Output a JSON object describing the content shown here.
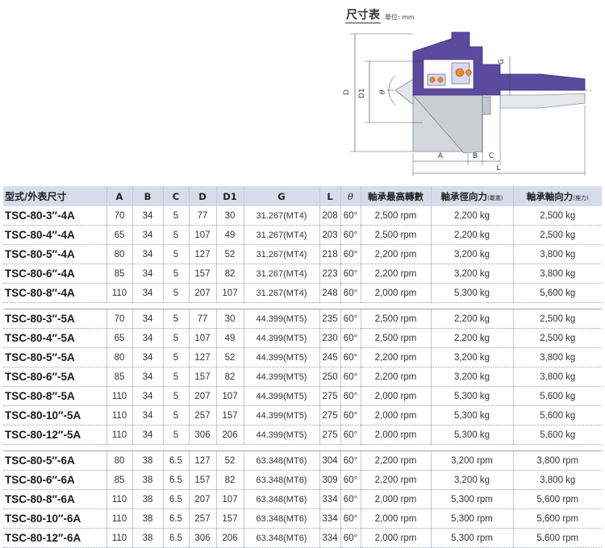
{
  "dimension_panel": {
    "title": "尺寸表",
    "unit": "單位: mm",
    "labels": {
      "D": "D",
      "D1": "D1",
      "theta": "θ",
      "G": "G",
      "A": "A",
      "B": "B",
      "C": "C",
      "L": "L"
    }
  },
  "table": {
    "headers": {
      "model": "型式/外表尺寸",
      "A": "A",
      "B": "B",
      "C": "C",
      "D": "D",
      "D1": "D1",
      "G": "G",
      "L": "L",
      "theta": "θ",
      "max_speed": "軸承最高轉數",
      "radial": "軸承徑向力",
      "radial_note": "(載重)",
      "axial": "軸承軸向力",
      "axial_note": "(推力)"
    },
    "groups": [
      {
        "rows": [
          {
            "model": "TSC-80-3″-4A",
            "A": "70",
            "B": "34",
            "C": "5",
            "D": "77",
            "D1": "30",
            "G": "31.267(MT4)",
            "L": "208",
            "theta": "60°",
            "max_speed": "2,500 rpm",
            "radial": "2,200 kg",
            "axial": "2,500 kg"
          },
          {
            "model": "TSC-80-4″-4A",
            "A": "65",
            "B": "34",
            "C": "5",
            "D": "107",
            "D1": "49",
            "G": "31.267(MT4)",
            "L": "203",
            "theta": "60°",
            "max_speed": "2,500 rpm",
            "radial": "2,200 kg",
            "axial": "2,500 kg"
          },
          {
            "model": "TSC-80-5″-4A",
            "A": "80",
            "B": "34",
            "C": "5",
            "D": "127",
            "D1": "52",
            "G": "31.267(MT4)",
            "L": "218",
            "theta": "60°",
            "max_speed": "2,200 rpm",
            "radial": "3,200 kg",
            "axial": "3,800 kg"
          },
          {
            "model": "TSC-80-6″-4A",
            "A": "85",
            "B": "34",
            "C": "5",
            "D": "157",
            "D1": "82",
            "G": "31.267(MT4)",
            "L": "223",
            "theta": "60°",
            "max_speed": "2,200 rpm",
            "radial": "3,200 kg",
            "axial": "3,800 kg"
          },
          {
            "model": "TSC-80-8″-4A",
            "A": "110",
            "B": "34",
            "C": "5",
            "D": "207",
            "D1": "107",
            "G": "31.267(MT4)",
            "L": "248",
            "theta": "60°",
            "max_speed": "2,000 rpm",
            "radial": "5,300 kg",
            "axial": "5,600 kg"
          }
        ]
      },
      {
        "rows": [
          {
            "model": "TSC-80-3″-5A",
            "A": "70",
            "B": "34",
            "C": "5",
            "D": "77",
            "D1": "30",
            "G": "44.399(MT5)",
            "L": "235",
            "theta": "60°",
            "max_speed": "2,500 rpm",
            "radial": "2,200 kg",
            "axial": "2,500 kg"
          },
          {
            "model": "TSC-80-4″-5A",
            "A": "65",
            "B": "34",
            "C": "5",
            "D": "107",
            "D1": "49",
            "G": "44.399(MT5)",
            "L": "230",
            "theta": "60°",
            "max_speed": "2,500 rpm",
            "radial": "2,200 kg",
            "axial": "2,500 kg"
          },
          {
            "model": "TSC-80-5″-5A",
            "A": "80",
            "B": "34",
            "C": "5",
            "D": "127",
            "D1": "52",
            "G": "44.399(MT5)",
            "L": "245",
            "theta": "60°",
            "max_speed": "2,200 rpm",
            "radial": "3,200 kg",
            "axial": "3,800 kg"
          },
          {
            "model": "TSC-80-6″-5A",
            "A": "85",
            "B": "34",
            "C": "5",
            "D": "157",
            "D1": "82",
            "G": "44.399(MT5)",
            "L": "250",
            "theta": "60°",
            "max_speed": "2,200 rpm",
            "radial": "3,200 kg",
            "axial": "3,800 kg"
          },
          {
            "model": "TSC-80-8″-5A",
            "A": "110",
            "B": "34",
            "C": "5",
            "D": "207",
            "D1": "107",
            "G": "44.399(MT5)",
            "L": "275",
            "theta": "60°",
            "max_speed": "2,000 rpm",
            "radial": "5,300 kg",
            "axial": "5,600 kg"
          },
          {
            "model": "TSC-80-10″-5A",
            "A": "110",
            "B": "34",
            "C": "5",
            "D": "257",
            "D1": "157",
            "G": "44.399(MT5)",
            "L": "275",
            "theta": "60°",
            "max_speed": "2,000 rpm",
            "radial": "5,300 kg",
            "axial": "5,600 kg"
          },
          {
            "model": "TSC-80-12″-5A",
            "A": "110",
            "B": "34",
            "C": "5",
            "D": "306",
            "D1": "206",
            "G": "44.399(MT5)",
            "L": "275",
            "theta": "60°",
            "max_speed": "2,000 rpm",
            "radial": "5,300 kg",
            "axial": "5,600 kg"
          }
        ]
      },
      {
        "rows": [
          {
            "model": "TSC-80-5″-6A",
            "A": "80",
            "B": "38",
            "C": "6.5",
            "D": "127",
            "D1": "52",
            "G": "63.348(MT6)",
            "L": "304",
            "theta": "60°",
            "max_speed": "2,200 rpm",
            "radial": "3,200 rpm",
            "axial": "3,800 rpm"
          },
          {
            "model": "TSC-80-6″-6A",
            "A": "85",
            "B": "38",
            "C": "6.5",
            "D": "157",
            "D1": "82",
            "G": "63.348(MT6)",
            "L": "309",
            "theta": "60°",
            "max_speed": "2,200 rpm",
            "radial": "3,200 kg",
            "axial": "3,800 kg"
          },
          {
            "model": "TSC-80-8″-6A",
            "A": "110",
            "B": "38",
            "C": "6.5",
            "D": "207",
            "D1": "107",
            "G": "63.348(MT6)",
            "L": "334",
            "theta": "60°",
            "max_speed": "2,000 rpm",
            "radial": "5,300 rpm",
            "axial": "5,600 rpm"
          },
          {
            "model": "TSC-80-10″-6A",
            "A": "110",
            "B": "38",
            "C": "6.5",
            "D": "257",
            "D1": "157",
            "G": "63.348(MT6)",
            "L": "334",
            "theta": "60°",
            "max_speed": "2,000 rpm",
            "radial": "5,300 rpm",
            "axial": "5,600 rpm"
          },
          {
            "model": "TSC-80-12″-6A",
            "A": "110",
            "B": "38",
            "C": "6.5",
            "D": "306",
            "D1": "206",
            "G": "63.348(MT6)",
            "L": "334",
            "theta": "60°",
            "max_speed": "2,000 rpm",
            "radial": "5,300 rpm",
            "axial": "5,600 rpm"
          }
        ]
      }
    ]
  },
  "colors": {
    "header_bg": "#d7dced",
    "body_purple": "#5b4b9e",
    "bearing_orange": "#f08a24"
  }
}
